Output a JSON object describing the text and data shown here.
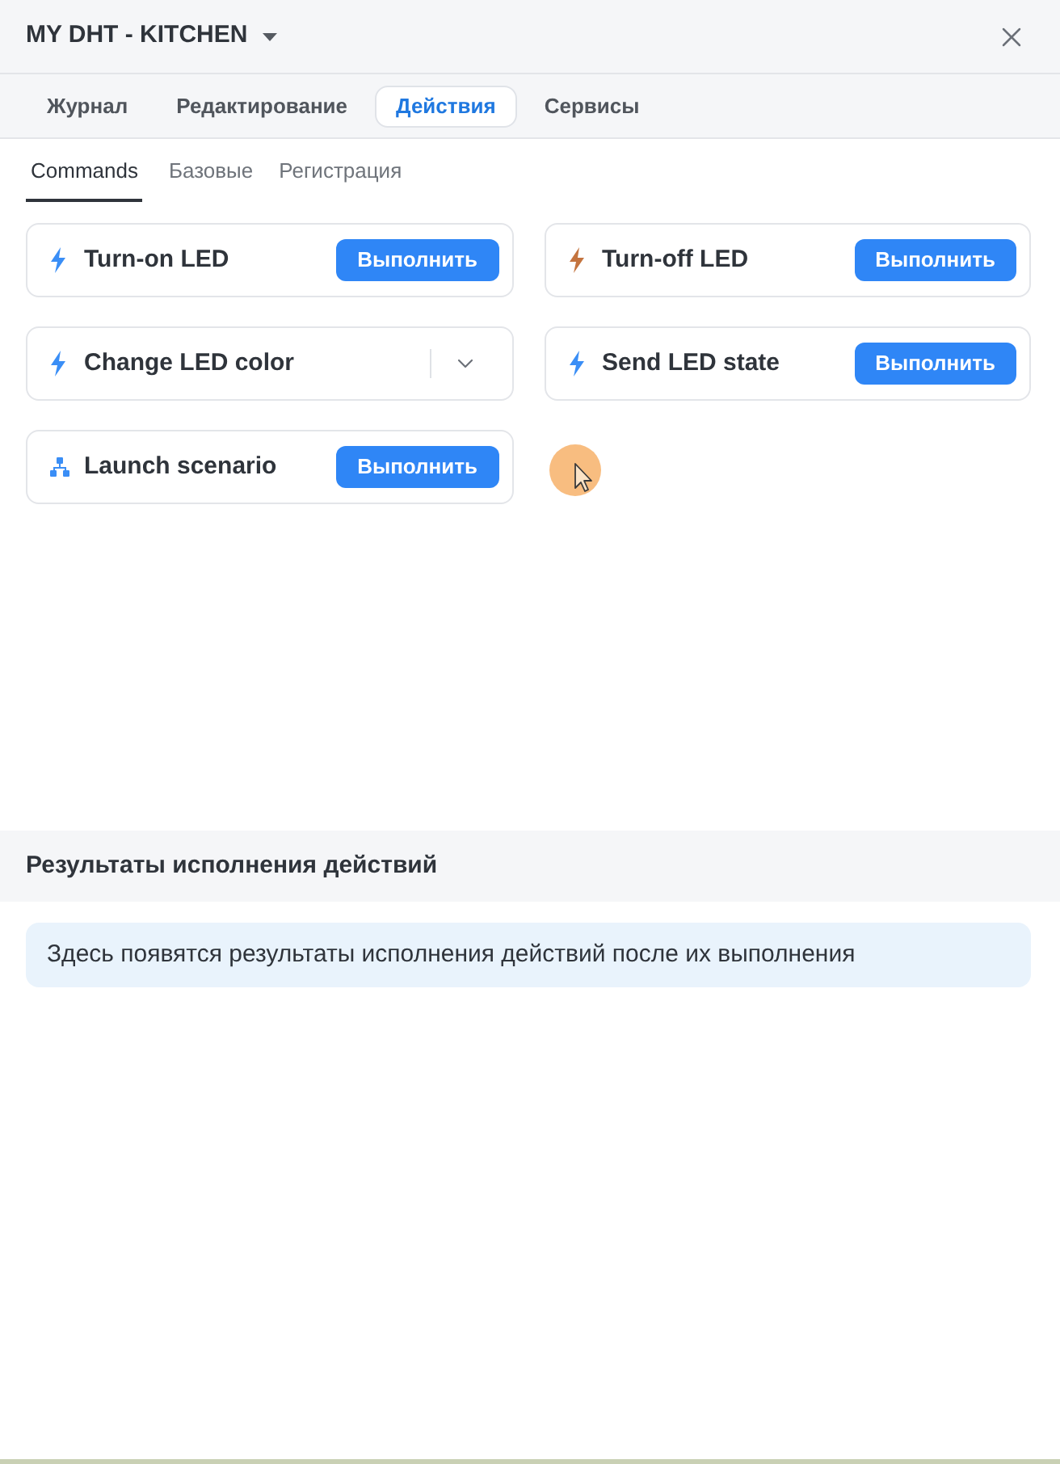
{
  "window": {
    "title": "MY DHT - KITCHEN"
  },
  "tabs": [
    {
      "label": "Журнал",
      "selected": false
    },
    {
      "label": "Редактирование",
      "selected": false
    },
    {
      "label": "Действия",
      "selected": true
    },
    {
      "label": "Сервисы",
      "selected": false
    }
  ],
  "subtabs": [
    {
      "label": "Commands",
      "selected": true
    },
    {
      "label": "Базовые",
      "selected": false
    },
    {
      "label": "Регистрация",
      "selected": false
    }
  ],
  "actions": [
    {
      "kind": "command",
      "label": "Turn-on LED",
      "color": "#3a8ef6",
      "button": "Выполнить"
    },
    {
      "kind": "command",
      "label": "Turn-off LED",
      "color": "#c4743f",
      "button": "Выполнить"
    },
    {
      "kind": "select",
      "label": "Change LED color",
      "color": "#3a8ef6"
    },
    {
      "kind": "command",
      "label": "Send LED state",
      "color": "#3a8ef6",
      "button": "Выполнить"
    },
    {
      "kind": "scenario",
      "label": "Launch scenario",
      "color": "#3a8ef6",
      "button": "Выполнить"
    }
  ],
  "results": {
    "title": "Результаты исполнения действий",
    "message": "Здесь появятся результаты исполнения действий после их выполнения"
  }
}
